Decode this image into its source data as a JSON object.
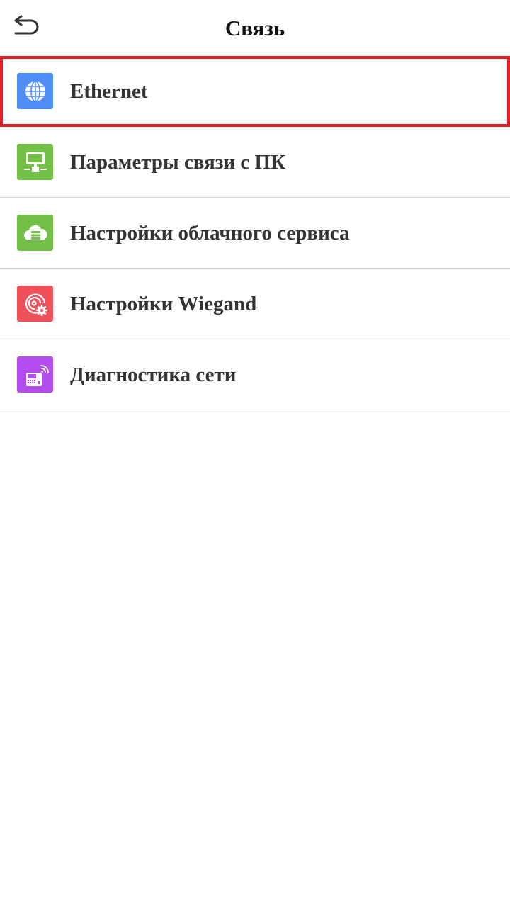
{
  "header": {
    "title": "Связь",
    "back_icon": "back-arrow-icon"
  },
  "menu": {
    "items": [
      {
        "label": "Ethernet",
        "icon": "globe-icon",
        "color": "#4f8ef7",
        "selected": true
      },
      {
        "label": "Параметры связи с ПК",
        "icon": "pc-connection-icon",
        "color": "#72c045",
        "selected": false
      },
      {
        "label": "Настройки облачного сервиса",
        "icon": "cloud-server-icon",
        "color": "#72c045",
        "selected": false
      },
      {
        "label": "Настройки Wiegand",
        "icon": "wiegand-gear-icon",
        "color": "#f0505a",
        "selected": false
      },
      {
        "label": "Диагностика сети",
        "icon": "network-diagnostics-icon",
        "color": "#b44cf0",
        "selected": false
      }
    ]
  },
  "colors": {
    "selection_border": "#e31e24",
    "divider": "#cfcfcf",
    "text": "#333333"
  }
}
